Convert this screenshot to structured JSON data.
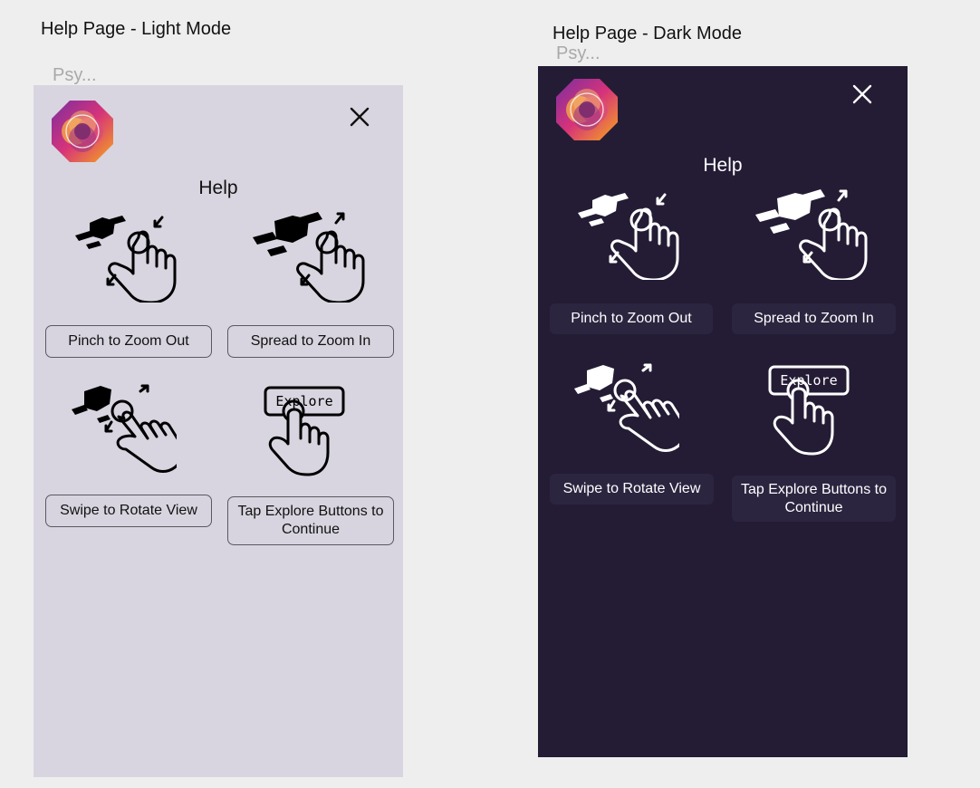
{
  "light_frame": {
    "frame_label": "Help Page - Light Mode",
    "app_name_truncated": "Psy...",
    "title": "Help",
    "buttons": {
      "pinch": "Pinch to Zoom Out",
      "spread": "Spread to Zoom In",
      "swipe": "Swipe to Rotate View",
      "tap": "Tap Explore Buttons to Continue"
    },
    "explore_label": "Explore"
  },
  "dark_frame": {
    "frame_label": "Help Page - Dark Mode",
    "app_name_truncated": "Psy...",
    "title": "Help",
    "buttons": {
      "pinch": "Pinch to Zoom Out",
      "spread": "Spread to Zoom In",
      "swipe": "Swipe to Rotate View",
      "tap": "Tap Explore Buttons to Continue"
    },
    "explore_label": "Explore"
  },
  "icons": {
    "logo": "app-logo-icon",
    "close": "close-icon",
    "pinch": "pinch-gesture-icon",
    "spread": "spread-gesture-icon",
    "swipe": "swipe-gesture-icon",
    "tap": "tap-gesture-icon"
  },
  "colors": {
    "canvas": "#eeeeee",
    "light_background": "#d8d5e0",
    "dark_background": "#241c35",
    "dark_button": "#2c2540",
    "logo_orange": "#f5a623",
    "logo_magenta": "#b83280",
    "logo_purple": "#6b2c91"
  }
}
